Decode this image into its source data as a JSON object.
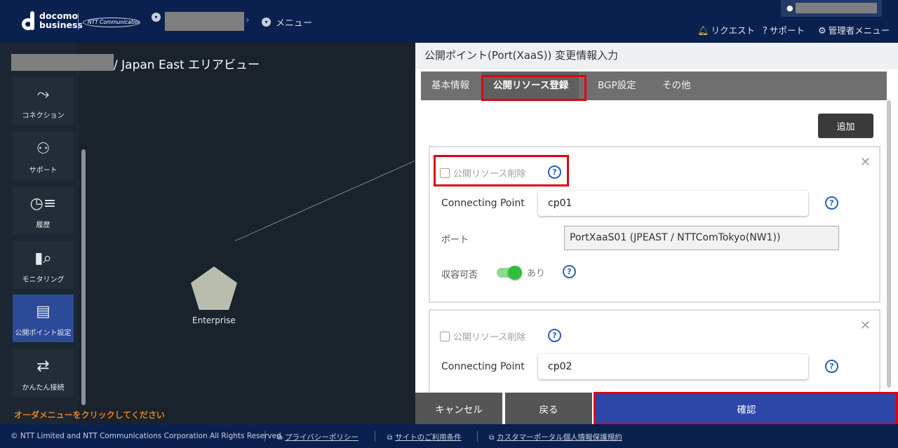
{
  "header": {
    "logo_line1": "docomo",
    "logo_line2": "business",
    "ntt_logo": "NTT Communications",
    "breadcrumb_menu": "メニュー",
    "nav_request": "リクエスト",
    "nav_support": "サポート",
    "nav_admin_menu": "管理者メニュー"
  },
  "map": {
    "title_suffix": "/ Japan East エリアビュー",
    "node_label": "Enterprise",
    "order_message": "オーダメニューをクリックしてください"
  },
  "sidebar": {
    "items": [
      {
        "label": "コネクション",
        "icon": "connection-icon"
      },
      {
        "label": "サポート",
        "icon": "support-user-icon"
      },
      {
        "label": "履歴",
        "icon": "history-icon"
      },
      {
        "label": "モニタリング",
        "icon": "monitoring-icon"
      },
      {
        "label": "公開ポイント設定",
        "icon": "public-point-icon"
      },
      {
        "label": "かんたん接続",
        "icon": "easy-connect-icon"
      }
    ],
    "active_index": 4
  },
  "dialog": {
    "title": "公開ポイント(Port(XaaS)) 変更情報入力",
    "tabs": [
      "基本情報",
      "公開リソース登録",
      "BGP設定",
      "その他"
    ],
    "active_tab": 1,
    "add_button": "追加",
    "cards": [
      {
        "delete_label": "公開リソース削除",
        "cp_label": "Connecting Point",
        "cp_value": "cp01",
        "port_label": "ポート",
        "port_value": "PortXaaS01 (JPEAST / NTTComTokyo(NW1))",
        "capacity_label": "収容可否",
        "capacity_toggle": "あり"
      },
      {
        "delete_label": "公開リソース削除",
        "cp_label": "Connecting Point",
        "cp_value": "cp02"
      }
    ],
    "buttons": {
      "cancel": "キャンセル",
      "back": "戻る",
      "confirm": "確認"
    }
  },
  "footer": {
    "copyright": "© NTT Limited and NTT Communications Corporation All Rights Reserved.",
    "privacy": "プライバシーポリシー",
    "terms": "サイトのご利用条件",
    "personal_info": "カスタマーポータル個人情報保護規約"
  },
  "colors": {
    "header_bg": "#0a2150",
    "primary_button": "#2d46a8",
    "highlight": "#e3000f",
    "order_message": "#e67e22"
  }
}
